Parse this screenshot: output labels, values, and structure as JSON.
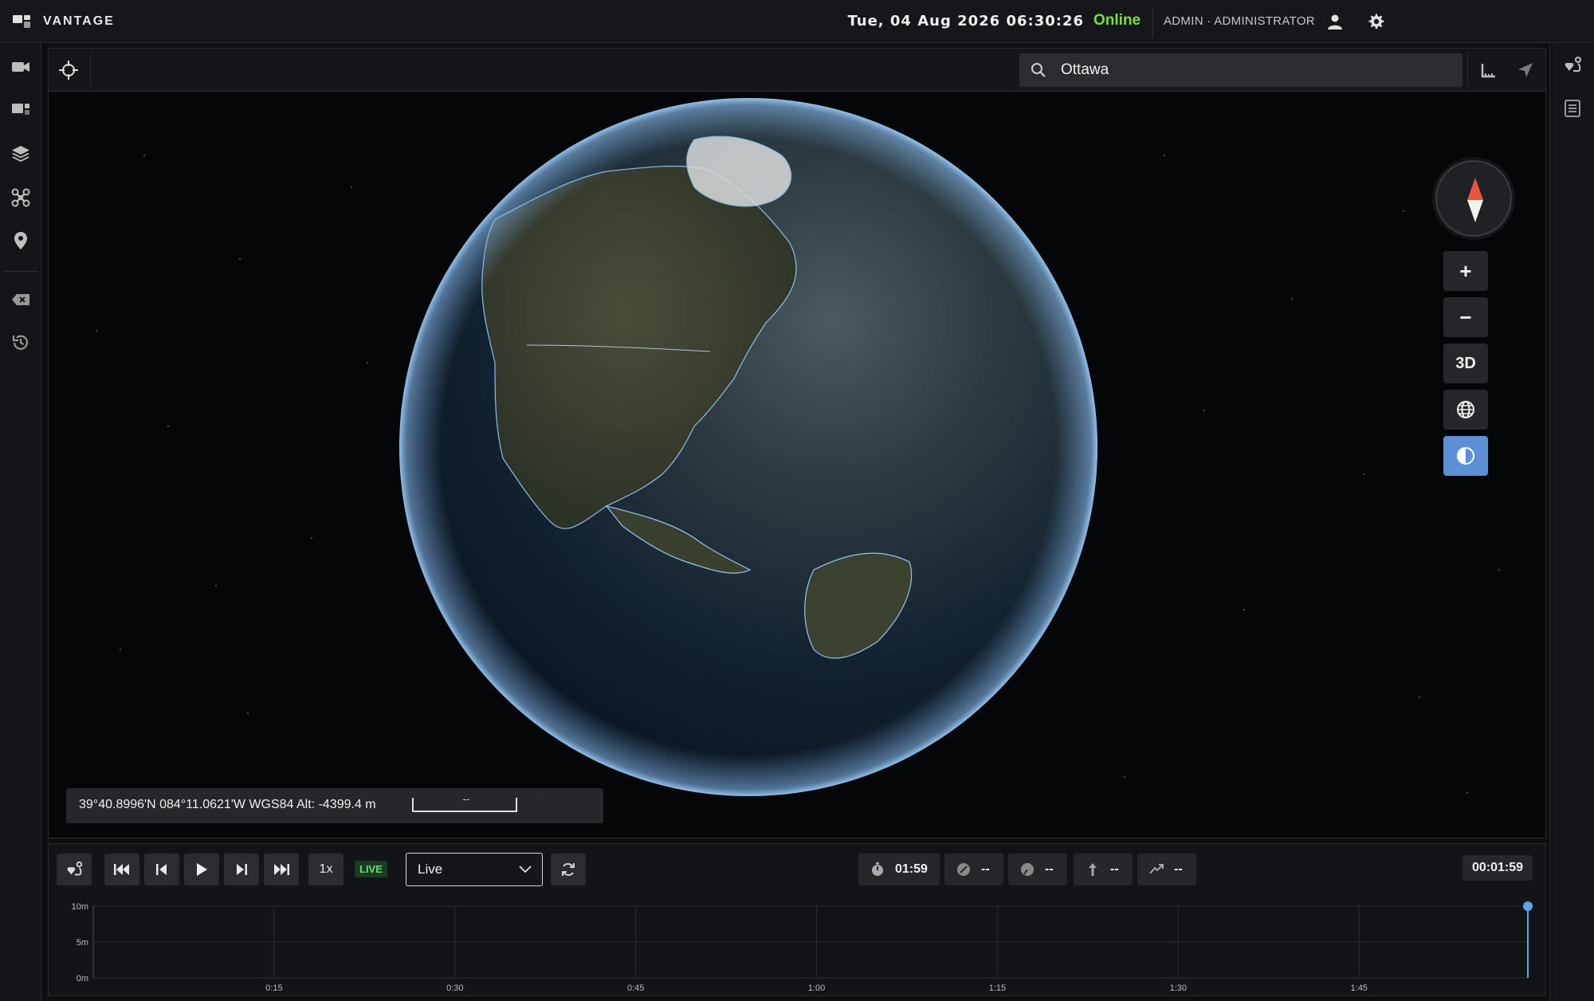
{
  "app": {
    "brand": "VANTAGE",
    "datetime": "Tue, 04 Aug 2026 06:30:26",
    "status": "Online",
    "status_color": "#7be13a",
    "user": "ADMIN · ADMINISTRATOR"
  },
  "leftbar": {
    "items": [
      {
        "icon": "camera-icon"
      },
      {
        "icon": "monitor-icon"
      },
      {
        "icon": "layers-icon"
      },
      {
        "icon": "drone-icon"
      },
      {
        "icon": "location-pin-icon"
      },
      {
        "icon": "clear-icon"
      },
      {
        "icon": "history-icon"
      }
    ]
  },
  "rightbar": {
    "items": [
      {
        "icon": "route-icon"
      },
      {
        "icon": "list-icon"
      }
    ]
  },
  "map": {
    "search": {
      "value": "Ottawa",
      "placeholder": "Search"
    },
    "coords": "39°40.8996'N 084°11.0621'W WGS84 Alt: -4399.4 m",
    "scale_label": "--",
    "controls": {
      "zoom_in": "+",
      "zoom_out": "−",
      "view_mode": "3D"
    },
    "accent": "#5b8fd6"
  },
  "timeline": {
    "speed": "1x",
    "live_badge": "LIVE",
    "mode_select": "Live",
    "metrics": [
      {
        "icon": "stopwatch-icon",
        "value": "01:59"
      },
      {
        "icon": "speed-icon",
        "value": "--"
      },
      {
        "icon": "gauge-icon",
        "value": "--"
      },
      {
        "icon": "altitude-icon",
        "value": "--"
      },
      {
        "icon": "climb-icon",
        "value": "--"
      }
    ],
    "elapsed": "00:01:59"
  },
  "chart_data": {
    "type": "line",
    "title": "",
    "xlabel": "",
    "ylabel": "",
    "y_ticks": [
      "10m",
      "5m",
      "0m"
    ],
    "x_ticks": [
      "0:15",
      "0:30",
      "0:45",
      "1:00",
      "1:15",
      "1:30",
      "1:45"
    ],
    "ylim": [
      0,
      10
    ],
    "xlim_seconds": [
      0,
      119
    ],
    "grid": true,
    "cursor_seconds": 119,
    "series": [
      {
        "values": []
      }
    ]
  }
}
